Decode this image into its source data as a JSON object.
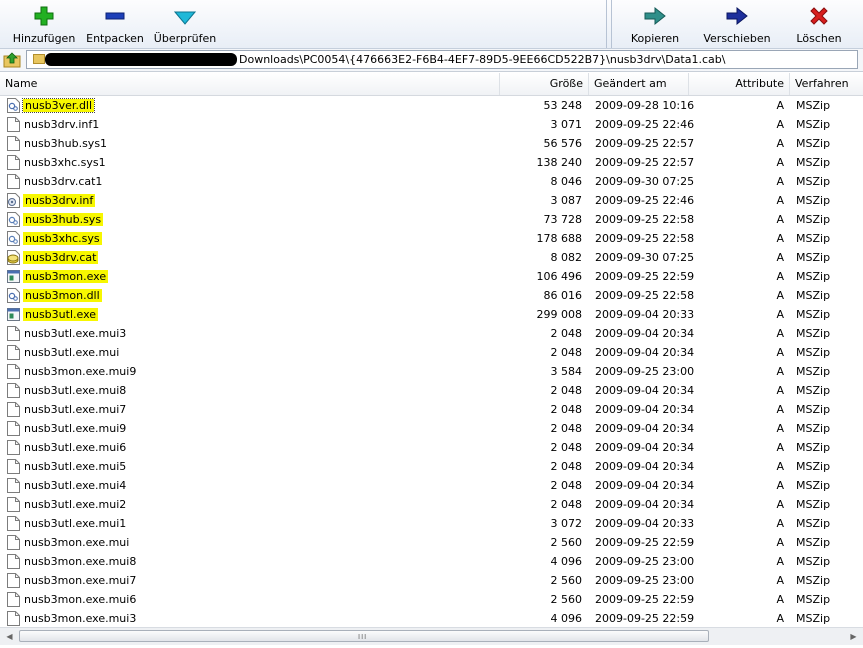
{
  "toolbar": {
    "buttons": [
      {
        "label": "Hinzufügen",
        "icon": "plus-icon",
        "color": "#22b022"
      },
      {
        "label": "Entpacken",
        "icon": "minus-icon",
        "color": "#1d3fb8"
      },
      {
        "label": "Überprüfen",
        "icon": "check-icon",
        "color": "#1fb8d8"
      },
      {
        "label": "Kopieren",
        "icon": "copy-arrow-icon",
        "color": "#2f8f8a"
      },
      {
        "label": "Verschieben",
        "icon": "move-arrow-icon",
        "color": "#1d2f9c"
      },
      {
        "label": "Löschen",
        "icon": "delete-x-icon",
        "color": "#d81e1e"
      }
    ]
  },
  "address": {
    "path": "Downloads\\PC0054\\{476663E2-F6B4-4EF7-89D5-9EE66CD522B7}\\nusb3drv\\Data1.cab\\"
  },
  "columns": {
    "name": "Name",
    "size": "Größe",
    "date": "Geändert am",
    "attr": "Attribute",
    "method": "Verfahren"
  },
  "files": [
    {
      "name": "nusb3ver.dll",
      "size": "53 248",
      "date": "2009-09-28 10:16",
      "attr": "A",
      "method": "MSZip",
      "icon": "dll-icon",
      "highlight": true,
      "focused": true
    },
    {
      "name": "nusb3drv.inf1",
      "size": "3 071",
      "date": "2009-09-25 22:46",
      "attr": "A",
      "method": "MSZip",
      "icon": "file-icon",
      "highlight": false
    },
    {
      "name": "nusb3hub.sys1",
      "size": "56 576",
      "date": "2009-09-25 22:57",
      "attr": "A",
      "method": "MSZip",
      "icon": "file-icon",
      "highlight": false
    },
    {
      "name": "nusb3xhc.sys1",
      "size": "138 240",
      "date": "2009-09-25 22:57",
      "attr": "A",
      "method": "MSZip",
      "icon": "file-icon",
      "highlight": false
    },
    {
      "name": "nusb3drv.cat1",
      "size": "8 046",
      "date": "2009-09-30 07:25",
      "attr": "A",
      "method": "MSZip",
      "icon": "file-icon",
      "highlight": false
    },
    {
      "name": "nusb3drv.inf",
      "size": "3 087",
      "date": "2009-09-25 22:46",
      "attr": "A",
      "method": "MSZip",
      "icon": "inf-icon",
      "highlight": true
    },
    {
      "name": "nusb3hub.sys",
      "size": "73 728",
      "date": "2009-09-25 22:58",
      "attr": "A",
      "method": "MSZip",
      "icon": "sys-icon",
      "highlight": true
    },
    {
      "name": "nusb3xhc.sys",
      "size": "178 688",
      "date": "2009-09-25 22:58",
      "attr": "A",
      "method": "MSZip",
      "icon": "sys-icon",
      "highlight": true
    },
    {
      "name": "nusb3drv.cat",
      "size": "8 082",
      "date": "2009-09-30 07:25",
      "attr": "A",
      "method": "MSZip",
      "icon": "cat-icon",
      "highlight": true
    },
    {
      "name": "nusb3mon.exe",
      "size": "106 496",
      "date": "2009-09-25 22:59",
      "attr": "A",
      "method": "MSZip",
      "icon": "exe-icon",
      "highlight": true
    },
    {
      "name": "nusb3mon.dll",
      "size": "86 016",
      "date": "2009-09-25 22:58",
      "attr": "A",
      "method": "MSZip",
      "icon": "dll-icon",
      "highlight": true
    },
    {
      "name": "nusb3utl.exe",
      "size": "299 008",
      "date": "2009-09-04 20:33",
      "attr": "A",
      "method": "MSZip",
      "icon": "exe-icon",
      "highlight": true
    },
    {
      "name": "nusb3utl.exe.mui3",
      "size": "2 048",
      "date": "2009-09-04 20:34",
      "attr": "A",
      "method": "MSZip",
      "icon": "file-icon",
      "highlight": false
    },
    {
      "name": "nusb3utl.exe.mui",
      "size": "2 048",
      "date": "2009-09-04 20:34",
      "attr": "A",
      "method": "MSZip",
      "icon": "file-icon",
      "highlight": false
    },
    {
      "name": "nusb3mon.exe.mui9",
      "size": "3 584",
      "date": "2009-09-25 23:00",
      "attr": "A",
      "method": "MSZip",
      "icon": "file-icon",
      "highlight": false
    },
    {
      "name": "nusb3utl.exe.mui8",
      "size": "2 048",
      "date": "2009-09-04 20:34",
      "attr": "A",
      "method": "MSZip",
      "icon": "file-icon",
      "highlight": false
    },
    {
      "name": "nusb3utl.exe.mui7",
      "size": "2 048",
      "date": "2009-09-04 20:34",
      "attr": "A",
      "method": "MSZip",
      "icon": "file-icon",
      "highlight": false
    },
    {
      "name": "nusb3utl.exe.mui9",
      "size": "2 048",
      "date": "2009-09-04 20:34",
      "attr": "A",
      "method": "MSZip",
      "icon": "file-icon",
      "highlight": false
    },
    {
      "name": "nusb3utl.exe.mui6",
      "size": "2 048",
      "date": "2009-09-04 20:34",
      "attr": "A",
      "method": "MSZip",
      "icon": "file-icon",
      "highlight": false
    },
    {
      "name": "nusb3utl.exe.mui5",
      "size": "2 048",
      "date": "2009-09-04 20:34",
      "attr": "A",
      "method": "MSZip",
      "icon": "file-icon",
      "highlight": false
    },
    {
      "name": "nusb3utl.exe.mui4",
      "size": "2 048",
      "date": "2009-09-04 20:34",
      "attr": "A",
      "method": "MSZip",
      "icon": "file-icon",
      "highlight": false
    },
    {
      "name": "nusb3utl.exe.mui2",
      "size": "2 048",
      "date": "2009-09-04 20:34",
      "attr": "A",
      "method": "MSZip",
      "icon": "file-icon",
      "highlight": false
    },
    {
      "name": "nusb3utl.exe.mui1",
      "size": "3 072",
      "date": "2009-09-04 20:33",
      "attr": "A",
      "method": "MSZip",
      "icon": "file-icon",
      "highlight": false
    },
    {
      "name": "nusb3mon.exe.mui",
      "size": "2 560",
      "date": "2009-09-25 22:59",
      "attr": "A",
      "method": "MSZip",
      "icon": "file-icon",
      "highlight": false
    },
    {
      "name": "nusb3mon.exe.mui8",
      "size": "4 096",
      "date": "2009-09-25 23:00",
      "attr": "A",
      "method": "MSZip",
      "icon": "file-icon",
      "highlight": false
    },
    {
      "name": "nusb3mon.exe.mui7",
      "size": "2 560",
      "date": "2009-09-25 23:00",
      "attr": "A",
      "method": "MSZip",
      "icon": "file-icon",
      "highlight": false
    },
    {
      "name": "nusb3mon.exe.mui6",
      "size": "2 560",
      "date": "2009-09-25 22:59",
      "attr": "A",
      "method": "MSZip",
      "icon": "file-icon",
      "highlight": false
    },
    {
      "name": "nusb3mon.exe.mui3",
      "size": "4 096",
      "date": "2009-09-25 22:59",
      "attr": "A",
      "method": "MSZip",
      "icon": "file-icon",
      "highlight": false
    }
  ],
  "scrollbar": {
    "grip": "III"
  },
  "colors": {
    "highlight": "#f7f700",
    "accent": "#1d3fb8"
  }
}
